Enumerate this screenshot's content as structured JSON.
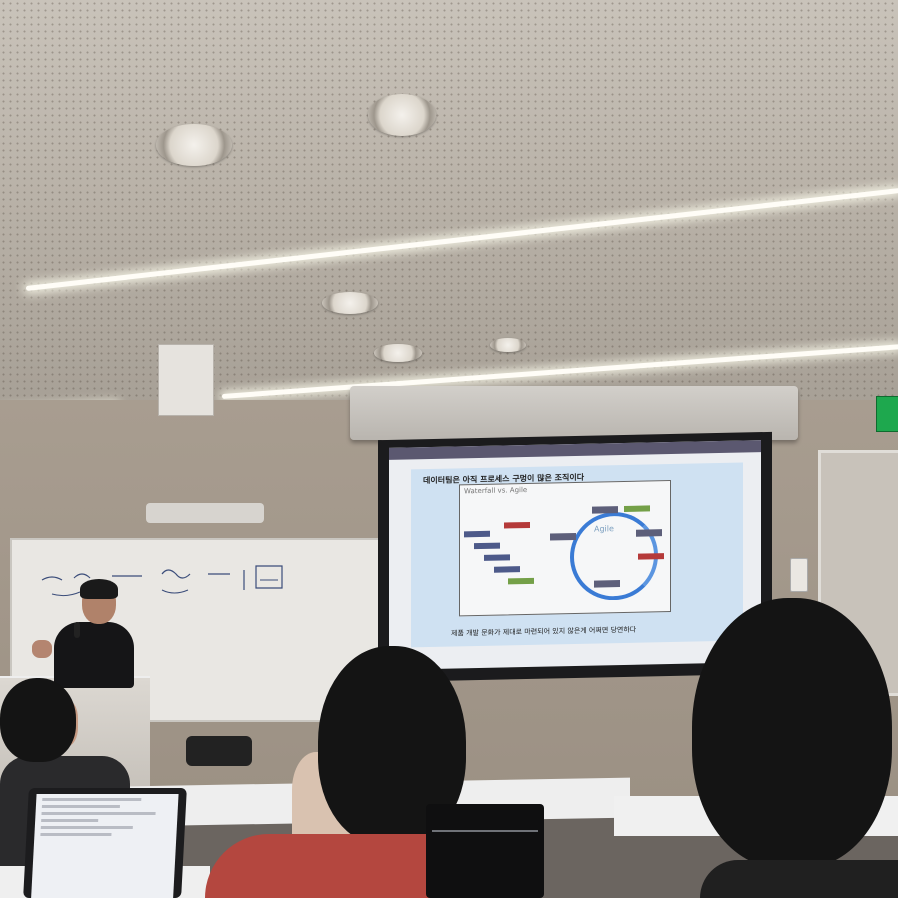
{
  "slide": {
    "title": "데이터팀은 아직 프로세스 구멍이 많은 조직이다",
    "diagram_title": "Waterfall vs. Agile",
    "agile_label": "Agile",
    "caption": "제품 개발 문화가 제대로 마련되어 있지 않은게 어쩌면 당연하다"
  },
  "colors": {
    "slide_background": "#cfe1f2",
    "agile_ring": "#3a7bd5",
    "exit_sign": "#1ea84e",
    "audience_shirt": "#b4473f"
  }
}
